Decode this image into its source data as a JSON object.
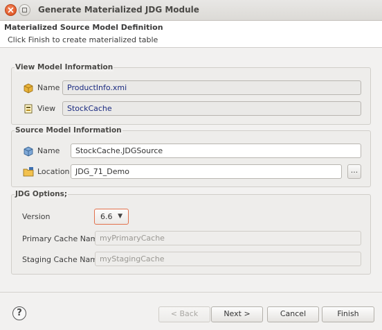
{
  "window": {
    "title": "Generate Materialized JDG Module"
  },
  "banner": {
    "title": "Materialized Source Model Definition",
    "message": "Click Finish to create materialized table"
  },
  "view_model": {
    "group_label": "View Model Information",
    "name_label": "Name",
    "name_value": "ProductInfo.xmi",
    "view_label": "View",
    "view_value": "StockCache"
  },
  "source_model": {
    "group_label": "Source Model Information",
    "name_label": "Name",
    "name_value": "StockCache.JDGSource",
    "location_label": "Location",
    "location_value": "JDG_71_Demo",
    "browse_label": "..."
  },
  "jdg_options": {
    "group_label": "JDG Options;",
    "version_label": "Version",
    "version_value": "6.6",
    "primary_cache_label": "Primary Cache Name",
    "primary_cache_value": "myPrimaryCache",
    "staging_cache_label": "Staging Cache Name",
    "staging_cache_value": "myStagingCache"
  },
  "buttons": {
    "help": "?",
    "back": "< Back",
    "next": "Next >",
    "cancel": "Cancel",
    "finish": "Finish"
  },
  "colors": {
    "close_button": "#e05a2a",
    "readonly_text": "#1a2a80",
    "combo_border": "#e2704b"
  }
}
